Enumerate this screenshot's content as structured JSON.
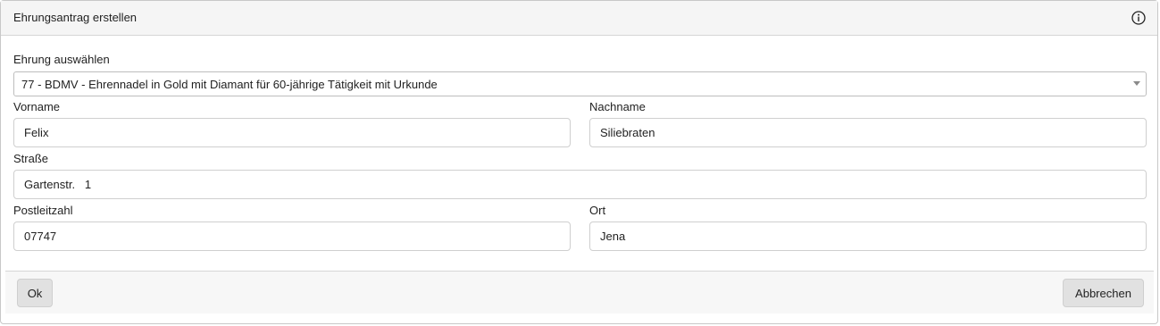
{
  "dialog": {
    "title": "Ehrungsantrag erstellen",
    "info_icon": "info-circle-icon"
  },
  "form": {
    "ehrung": {
      "label": "Ehrung auswählen",
      "selected": "77 - BDMV - Ehrennadel in Gold mit Diamant für 60-jährige Tätigkeit mit Urkunde"
    },
    "vorname": {
      "label": "Vorname",
      "value": "Felix"
    },
    "nachname": {
      "label": "Nachname",
      "value": "Siliebraten"
    },
    "strasse": {
      "label": "Straße",
      "value": "Gartenstr.   1"
    },
    "plz": {
      "label": "Postleitzahl",
      "value": "07747"
    },
    "ort": {
      "label": "Ort",
      "value": "Jena"
    }
  },
  "footer": {
    "ok_label": "Ok",
    "cancel_label": "Abbrechen"
  }
}
